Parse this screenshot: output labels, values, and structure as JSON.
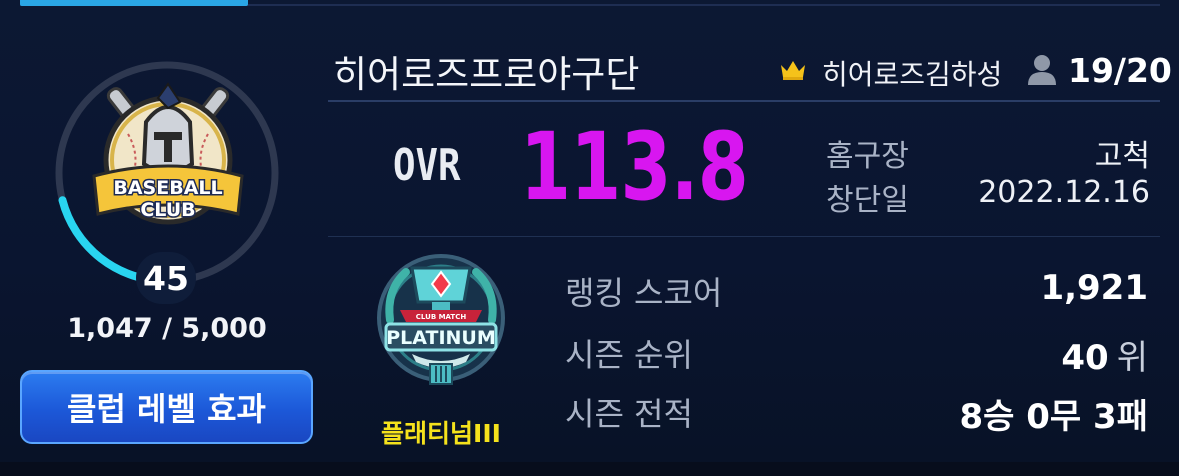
{
  "club": {
    "name": "히어로즈프로야구단",
    "owner": "히어로즈김하성",
    "members": "19/20",
    "level": "45",
    "level_progress": 0.2094,
    "exp": "1,047 / 5,000",
    "effect_button": "클럽 레벨 효과",
    "logo_text_top": "BASEBALL",
    "logo_text_bottom": "CLUB"
  },
  "ovr": {
    "label": "OVR",
    "value": "113.8"
  },
  "info": {
    "stadium_label": "홈구장",
    "stadium_value": "고척",
    "founded_label": "창단일",
    "founded_value": "2022.12.16"
  },
  "league": {
    "name": "플래티넘III",
    "emblem_text": "PLATINUM",
    "emblem_banner": "CLUB MATCH"
  },
  "stats": {
    "rank_score_label": "랭킹 스코어",
    "rank_score_value": "1,921",
    "season_rank_label": "시즌 순위",
    "season_rank_value": "40",
    "season_rank_unit": "위",
    "season_record_label": "시즌 전적",
    "season_record_value": "8승 0무 3패"
  },
  "colors": {
    "ovr": "#d816f0",
    "league_name": "#f5e21c",
    "ring_progress": "#29d5f0",
    "ring_track": "#2e3850",
    "button": "#1c58d8"
  },
  "icons": {
    "crown": "crown-icon",
    "member": "person-icon"
  }
}
